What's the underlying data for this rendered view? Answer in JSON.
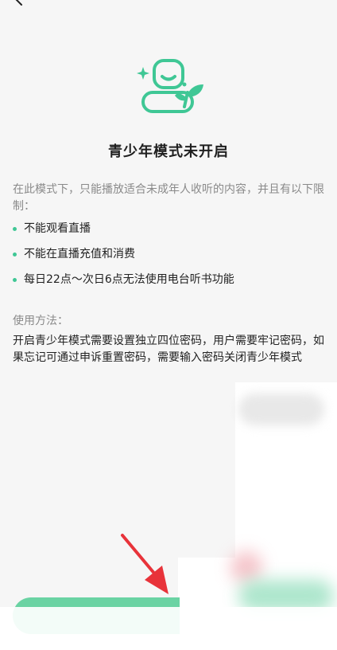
{
  "header": {
    "back_icon": "chevron-left-icon"
  },
  "hero": {
    "icon": "teen-mode-sprout-icon",
    "accent_color": "#3fc795"
  },
  "title": "青少年模式未开启",
  "intro": "在此模式下，只能播放适合未成年人收听的内容，并且有以下限制：",
  "rules": [
    "不能观看直播",
    "不能在直播充值和消费",
    "每日22点～次日6点无法使用电台听书功能"
  ],
  "usage": {
    "label": "使用方法：",
    "text": "开启青少年模式需要设置独立四位密码，用户需要牢记密码，如果忘记可通过申诉重置密码，需要输入密码关闭青少年模式"
  },
  "action": {
    "button_color": "#6ad3a3",
    "annotation_icon": "red-arrow-pointer-icon",
    "annotation_color": "#e8333a"
  }
}
